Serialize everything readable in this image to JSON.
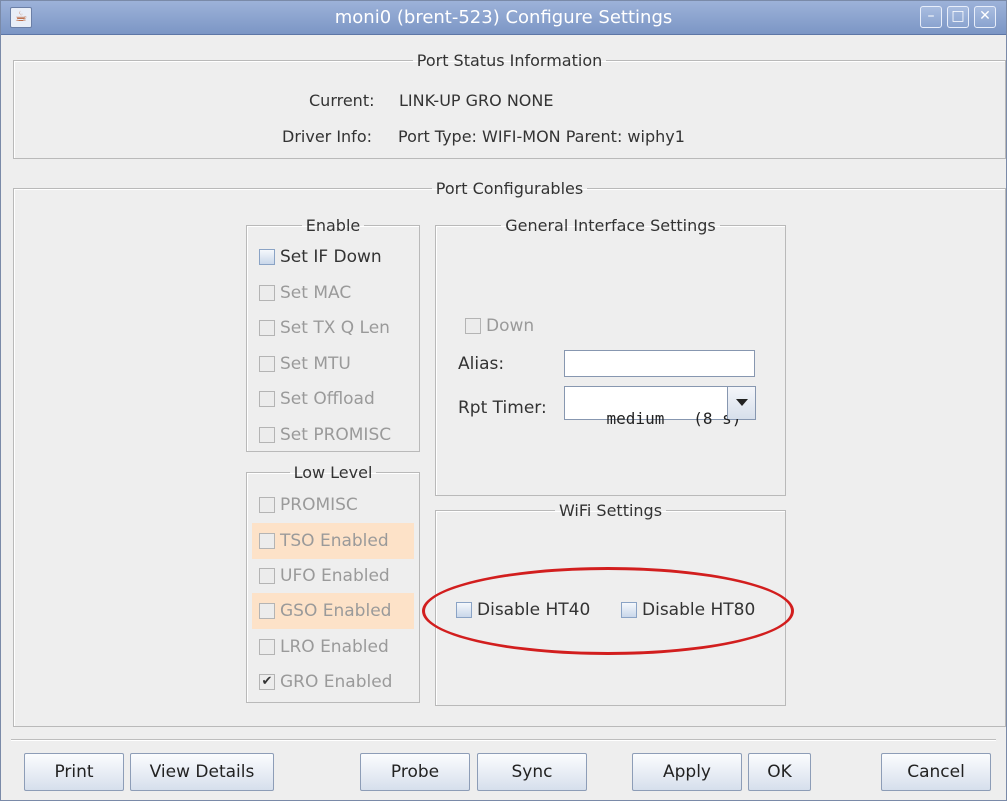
{
  "window": {
    "title": "moni0  (brent-523) Configure Settings",
    "icons": [
      "java-app-icon",
      "minimize-icon",
      "maximize-icon",
      "close-icon"
    ],
    "minimize_glyph": "–",
    "maximize_glyph": "□",
    "close_glyph": "✕"
  },
  "status": {
    "legend": "Port Status Information",
    "current_label": "Current:",
    "current_value": "LINK-UP GRO  NONE",
    "driver_label": "Driver Info:",
    "driver_value": "Port Type: WIFI-MON   Parent: wiphy1"
  },
  "configurables": {
    "legend": "Port Configurables",
    "enable": {
      "legend": "Enable",
      "items": [
        {
          "label": "Set IF Down",
          "checked": false,
          "enabled": true
        },
        {
          "label": "Set MAC",
          "checked": false,
          "enabled": false
        },
        {
          "label": "Set TX Q Len",
          "checked": false,
          "enabled": false
        },
        {
          "label": "Set MTU",
          "checked": false,
          "enabled": false
        },
        {
          "label": "Set Offload",
          "checked": false,
          "enabled": false
        },
        {
          "label": "Set PROMISC",
          "checked": false,
          "enabled": false
        }
      ]
    },
    "low_level": {
      "legend": "Low Level",
      "items": [
        {
          "label": "PROMISC",
          "checked": false,
          "enabled": false
        },
        {
          "label": "TSO Enabled",
          "checked": false,
          "enabled": false
        },
        {
          "label": "UFO Enabled",
          "checked": false,
          "enabled": false
        },
        {
          "label": "GSO Enabled",
          "checked": false,
          "enabled": false
        },
        {
          "label": "LRO Enabled",
          "checked": false,
          "enabled": false
        },
        {
          "label": "GRO Enabled",
          "checked": true,
          "enabled": false
        }
      ],
      "check_glyph": "✔"
    },
    "general": {
      "legend": "General Interface Settings",
      "down_label": "Down",
      "alias_label": "Alias:",
      "alias_value": "",
      "rpt_timer_label": "Rpt Timer:",
      "rpt_timer_value": "medium   (8 s)"
    },
    "wifi": {
      "legend": "WiFi Settings",
      "disable_ht40": "Disable HT40",
      "disable_ht80": "Disable HT80"
    }
  },
  "buttons": {
    "print": "Print",
    "view_details": "View Details",
    "probe": "Probe",
    "sync": "Sync",
    "apply": "Apply",
    "ok": "OK",
    "cancel": "Cancel"
  },
  "colors": {
    "title_bar": "#8aa3cf",
    "highlight": "#fde2c8",
    "annotation_circle": "#d21e1e"
  }
}
